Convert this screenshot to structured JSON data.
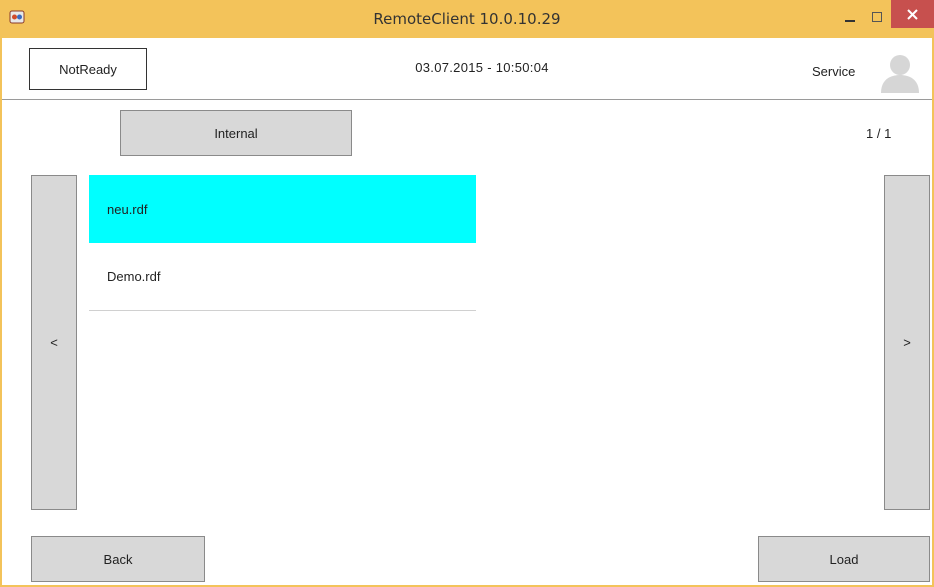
{
  "window": {
    "title": "RemoteClient 10.0.10.29",
    "titlebar_color": "#f3c35a",
    "close_color": "#c7504e"
  },
  "header": {
    "status": "NotReady",
    "datetime": "03.07.2015  -  10:50:04",
    "user_label": "Service",
    "avatar_icon": "user-avatar-icon"
  },
  "toolbar": {
    "source_label": "Internal",
    "page_counter": "1 / 1"
  },
  "navigation": {
    "prev_label": "<",
    "next_label": ">"
  },
  "files": {
    "selected_color": "#00ffff",
    "items": [
      {
        "name": "neu.rdf",
        "selected": true
      },
      {
        "name": "Demo.rdf",
        "selected": false
      }
    ]
  },
  "footer": {
    "back_label": "Back",
    "load_label": "Load"
  }
}
